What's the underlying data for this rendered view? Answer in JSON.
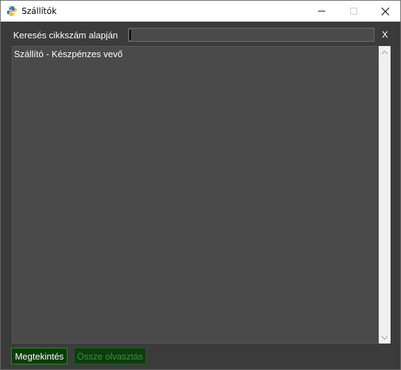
{
  "window": {
    "title": "Szállítók"
  },
  "search": {
    "label": "Keresés cikkszám alapján",
    "value": "",
    "clear_label": "X"
  },
  "list": {
    "items": [
      {
        "label": "Szállító - Készpénzes vevő"
      }
    ]
  },
  "buttons": {
    "view_label": "Megtekintés",
    "merge_label": "Össze olvasztás"
  },
  "colors": {
    "background": "#3b3b3b",
    "list_background": "#4a4a4a",
    "button_background": "#0c3d0c",
    "disabled_text": "#3f8f3f"
  },
  "icons": {
    "app": "python-icon",
    "minimize": "minimize-icon",
    "maximize": "maximize-icon",
    "close": "close-icon"
  }
}
